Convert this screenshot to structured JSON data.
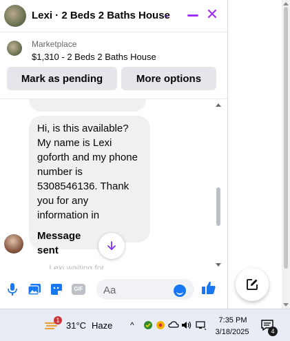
{
  "header": {
    "title": "Lexi · 2 Beds 2 Baths House",
    "icons": [
      "chevron-down-icon",
      "minimize-icon",
      "close-icon"
    ],
    "accent": "#a42ff7"
  },
  "marketplace": {
    "label": "Marketplace",
    "listing": "$1,310 - 2 Beds 2 Baths House",
    "mark_pending": "Mark as pending",
    "more_options": "More options"
  },
  "messages": {
    "main_text": "Hi, is this available? My name is Lexi goforth and my phone number is 5308546136. Thank you for any information in advance.",
    "sent_text": "Message sent",
    "partial_text": "... Lexi waiting for..."
  },
  "composer": {
    "placeholder": "Aa",
    "icons": [
      "microphone-icon",
      "photo-icon",
      "sticker-icon",
      "gif-icon",
      "emoji-icon",
      "like-icon"
    ],
    "gif_label": "GIF",
    "accent": "#1877f2"
  },
  "taskbar": {
    "temperature": "31°C",
    "condition": "Haze",
    "weather_badge": "1",
    "time": "7:35 PM",
    "date": "3/18/2025",
    "notification_count": "4"
  }
}
